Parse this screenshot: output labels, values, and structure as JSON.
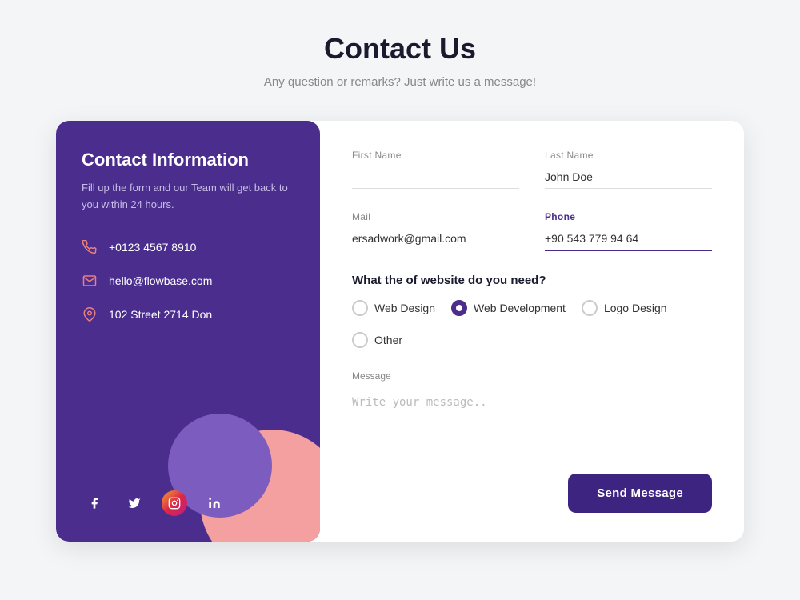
{
  "page": {
    "title": "Contact Us",
    "subtitle": "Any question or remarks? Just write us a message!"
  },
  "left_panel": {
    "heading": "Contact Information",
    "description": "Fill up the form and our Team will get back to you within 24 hours.",
    "phone": "+0123 4567 8910",
    "email": "hello@flowbase.com",
    "address": "102 Street 2714 Don",
    "social": {
      "facebook_label": "f",
      "twitter_label": "t",
      "instagram_label": "instagram",
      "linkedin_label": "in"
    }
  },
  "form": {
    "first_name_label": "First Name",
    "first_name_placeholder": "",
    "last_name_label": "Last Name",
    "last_name_value": "John Doe",
    "mail_label": "Mail",
    "mail_value": "ersadwork@gmail.com",
    "phone_label": "Phone",
    "phone_value": "+90 543 779 94 64",
    "website_question": "What the of website do you need?",
    "radio_options": [
      {
        "id": "web-design",
        "label": "Web Design",
        "checked": false
      },
      {
        "id": "web-development",
        "label": "Web Development",
        "checked": true
      },
      {
        "id": "logo-design",
        "label": "Logo Design",
        "checked": false
      },
      {
        "id": "other",
        "label": "Other",
        "checked": false
      }
    ],
    "message_label": "Message",
    "message_placeholder": "Write your message..",
    "send_button_label": "Send Message"
  }
}
